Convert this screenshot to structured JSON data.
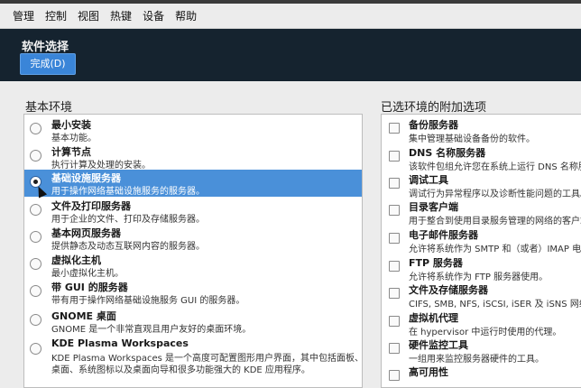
{
  "menubar": {
    "items": [
      "管理",
      "控制",
      "视图",
      "热键",
      "设备",
      "帮助"
    ]
  },
  "header": {
    "title": "软件选择",
    "done_label": "完成(D)"
  },
  "base_environment": {
    "heading": "基本环境",
    "items": [
      {
        "name": "最小安装",
        "desc": "基本功能。",
        "selected": false
      },
      {
        "name": "计算节点",
        "desc": "执行计算及处理的安装。",
        "selected": false
      },
      {
        "name": "基础设施服务器",
        "desc": "用于操作网络基础设施服务的服务器。",
        "selected": true
      },
      {
        "name": "文件及打印服务器",
        "desc": "用于企业的文件、打印及存储服务器。",
        "selected": false
      },
      {
        "name": "基本网页服务器",
        "desc": "提供静态及动态互联网内容的服务器。",
        "selected": false
      },
      {
        "name": "虚拟化主机",
        "desc": "最小虚拟化主机。",
        "selected": false
      },
      {
        "name": "带 GUI 的服务器",
        "desc": "带有用于操作网络基础设施服务 GUI 的服务器。",
        "selected": false
      },
      {
        "name": "GNOME 桌面",
        "desc": "GNOME 是一个非常直观且用户友好的桌面环境。",
        "selected": false
      },
      {
        "name": "KDE Plasma Workspaces",
        "desc": "KDE Plasma Workspaces 是一个高度可配置图形用户界面，其中包括面板、",
        "desc2": "桌面、系统图标以及桌面向导和很多功能强大的 KDE 应用程序。",
        "selected": false
      }
    ]
  },
  "addons": {
    "heading": "已选环境的附加选项",
    "items": [
      {
        "name": "备份服务器",
        "desc": "集中管理基础设备备份的软件。"
      },
      {
        "name": "DNS 名称服务器",
        "desc": "该软件包组允许您在系统上运行 DNS 名称服"
      },
      {
        "name": "调试工具",
        "desc": "调试行为异常程序以及诊断性能问题的工具。"
      },
      {
        "name": "目录客户端",
        "desc": "用于整合到使用目录服务管理的网络的客户端"
      },
      {
        "name": "电子邮件服务器",
        "desc": "允许将系统作为 SMTP 和（或者）IMAP 电子"
      },
      {
        "name": "FTP 服务器",
        "desc": "允许将系统作为 FTP 服务器使用。"
      },
      {
        "name": "文件及存储服务器",
        "desc": "CIFS, SMB, NFS, iSCSI, iSER 及 iSNS 网络"
      },
      {
        "name": "虚拟机代理",
        "desc": "在 hypervisor 中运行时使用的代理。"
      },
      {
        "name": "硬件监控工具",
        "desc": "一组用来监控服务器硬件的工具。"
      },
      {
        "name": "高可用性"
      }
    ]
  }
}
